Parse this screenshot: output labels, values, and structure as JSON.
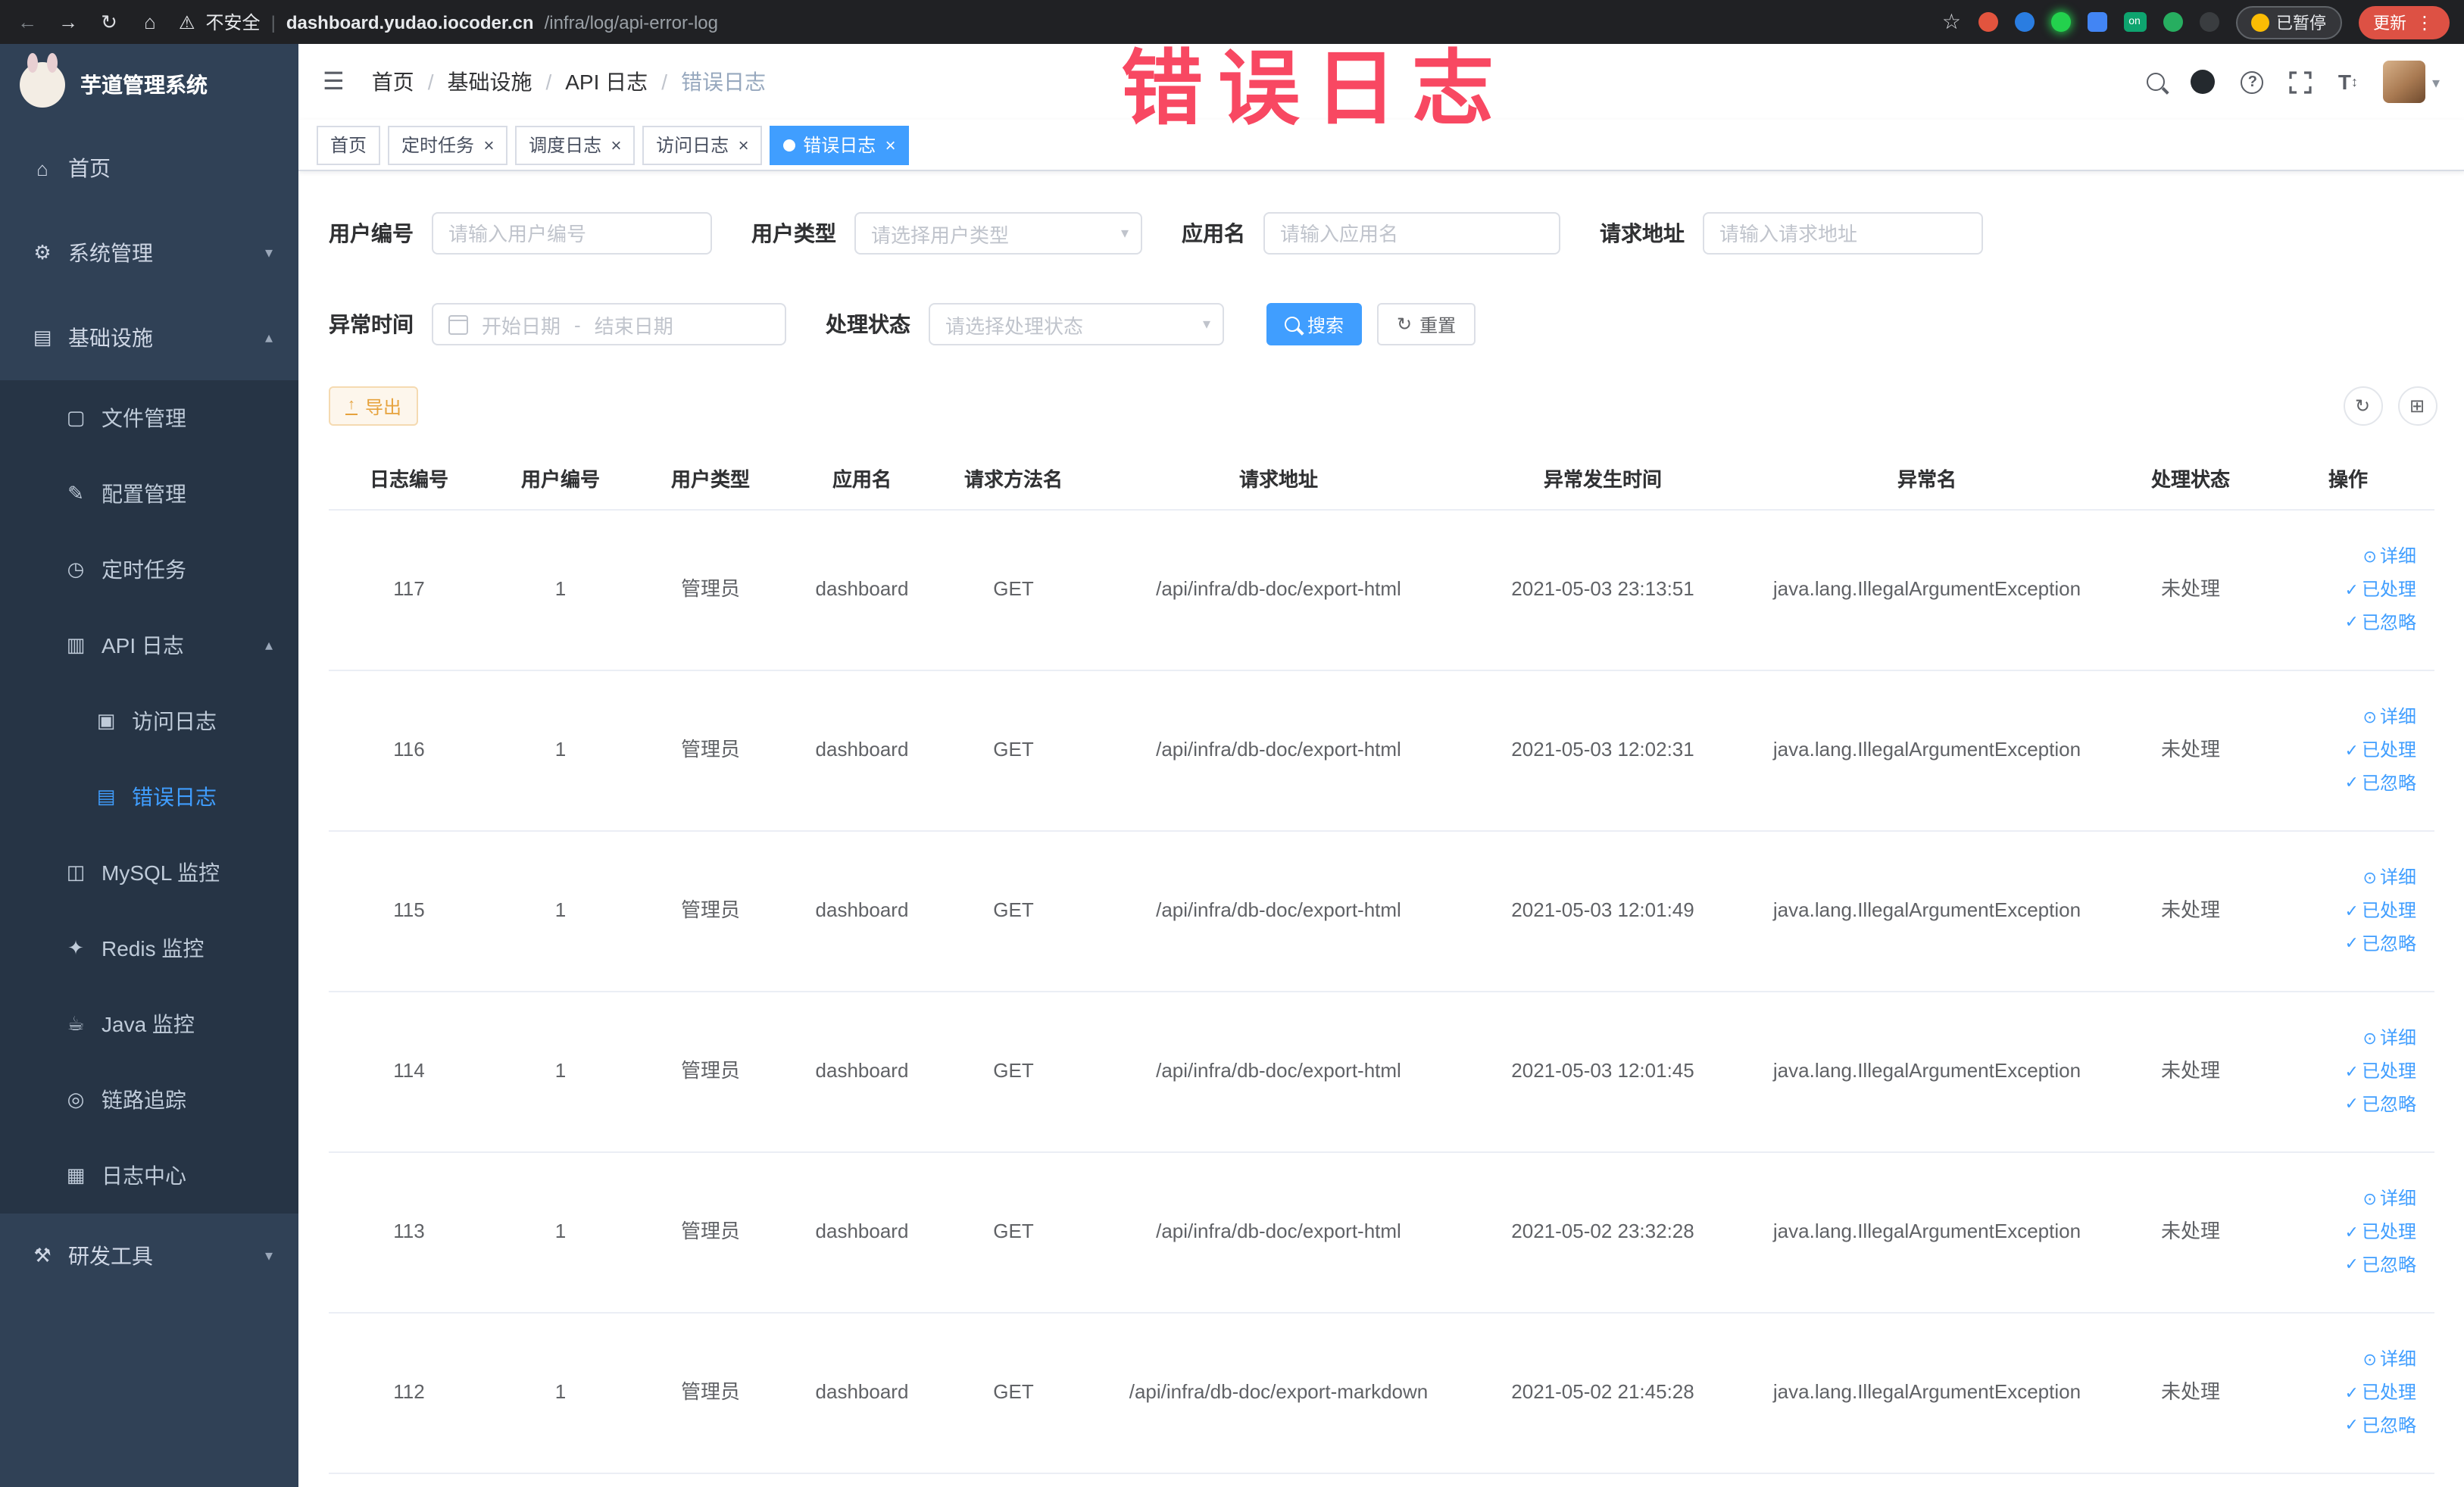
{
  "browser": {
    "security_label": "不安全",
    "url_domain": "dashboard.yudao.iocoder.cn",
    "url_path": "/infra/log/api-error-log",
    "extension_on_label": "on",
    "paused_label": "已暂停",
    "update_label": "更新"
  },
  "annotation": {
    "text": "错误日志"
  },
  "sidebar": {
    "logo_title": "芋道管理系统",
    "items": [
      {
        "label": "首页",
        "icon": "home",
        "level": 1
      },
      {
        "label": "系统管理",
        "icon": "gear",
        "level": 1,
        "arrow": "down"
      },
      {
        "label": "基础设施",
        "icon": "infra",
        "level": 1,
        "arrow": "up"
      },
      {
        "label": "文件管理",
        "icon": "file",
        "level": 2
      },
      {
        "label": "配置管理",
        "icon": "config",
        "level": 2
      },
      {
        "label": "定时任务",
        "icon": "job",
        "level": 2
      },
      {
        "label": "API 日志",
        "icon": "api-log",
        "level": 2,
        "arrow": "up"
      },
      {
        "label": "访问日志",
        "icon": "access-log",
        "level": 3
      },
      {
        "label": "错误日志",
        "icon": "error-log",
        "level": 3,
        "active": true
      },
      {
        "label": "MySQL 监控",
        "icon": "mysql",
        "level": 2
      },
      {
        "label": "Redis 监控",
        "icon": "redis",
        "level": 2
      },
      {
        "label": "Java 监控",
        "icon": "java",
        "level": 2
      },
      {
        "label": "链路追踪",
        "icon": "trace",
        "level": 2
      },
      {
        "label": "日志中心",
        "icon": "log-center",
        "level": 2
      },
      {
        "label": "研发工具",
        "icon": "tools",
        "level": 1,
        "arrow": "down"
      }
    ]
  },
  "breadcrumb": [
    "首页",
    "基础设施",
    "API 日志",
    "错误日志"
  ],
  "tabs": [
    {
      "label": "首页"
    },
    {
      "label": "定时任务",
      "closable": true
    },
    {
      "label": "调度日志",
      "closable": true
    },
    {
      "label": "访问日志",
      "closable": true
    },
    {
      "label": "错误日志",
      "closable": true,
      "active": true
    }
  ],
  "filters": {
    "user_id": {
      "label": "用户编号",
      "placeholder": "请输入用户编号"
    },
    "user_type": {
      "label": "用户类型",
      "placeholder": "请选择用户类型"
    },
    "app_name": {
      "label": "应用名",
      "placeholder": "请输入应用名"
    },
    "request_url": {
      "label": "请求地址",
      "placeholder": "请输入请求地址"
    },
    "exception_time": {
      "label": "异常时间",
      "start_placeholder": "开始日期",
      "separator": "-",
      "end_placeholder": "结束日期"
    },
    "process_status": {
      "label": "处理状态",
      "placeholder": "请选择处理状态"
    },
    "search_label": "搜索",
    "reset_label": "重置"
  },
  "toolbar": {
    "export_label": "导出"
  },
  "table": {
    "columns": [
      "日志编号",
      "用户编号",
      "用户类型",
      "应用名",
      "请求方法名",
      "请求地址",
      "异常发生时间",
      "异常名",
      "处理状态",
      "操作"
    ],
    "actions": [
      "详细",
      "已处理",
      "已忽略"
    ],
    "rows": [
      {
        "log_id": "117",
        "user_id": "1",
        "user_type": "管理员",
        "app_name": "dashboard",
        "method": "GET",
        "url": "/api/infra/db-doc/export-html",
        "time": "2021-05-03 23:13:51",
        "exception": "java.lang.IllegalArgumentException",
        "status": "未处理"
      },
      {
        "log_id": "116",
        "user_id": "1",
        "user_type": "管理员",
        "app_name": "dashboard",
        "method": "GET",
        "url": "/api/infra/db-doc/export-html",
        "time": "2021-05-03 12:02:31",
        "exception": "java.lang.IllegalArgumentException",
        "status": "未处理"
      },
      {
        "log_id": "115",
        "user_id": "1",
        "user_type": "管理员",
        "app_name": "dashboard",
        "method": "GET",
        "url": "/api/infra/db-doc/export-html",
        "time": "2021-05-03 12:01:49",
        "exception": "java.lang.IllegalArgumentException",
        "status": "未处理"
      },
      {
        "log_id": "114",
        "user_id": "1",
        "user_type": "管理员",
        "app_name": "dashboard",
        "method": "GET",
        "url": "/api/infra/db-doc/export-html",
        "time": "2021-05-03 12:01:45",
        "exception": "java.lang.IllegalArgumentException",
        "status": "未处理"
      },
      {
        "log_id": "113",
        "user_id": "1",
        "user_type": "管理员",
        "app_name": "dashboard",
        "method": "GET",
        "url": "/api/infra/db-doc/export-html",
        "time": "2021-05-02 23:32:28",
        "exception": "java.lang.IllegalArgumentException",
        "status": "未处理"
      },
      {
        "log_id": "112",
        "user_id": "1",
        "user_type": "管理员",
        "app_name": "dashboard",
        "method": "GET",
        "url": "/api/infra/db-doc/export-markdown",
        "time": "2021-05-02 21:45:28",
        "exception": "java.lang.IllegalArgumentException",
        "status": "未处理"
      }
    ]
  }
}
